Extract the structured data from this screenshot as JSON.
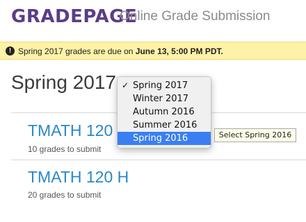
{
  "header": {
    "logo": "GRADEPAGE",
    "subtitle": "Online Grade Submission"
  },
  "banner": {
    "icon": "!",
    "text_prefix": "Spring 2017 grades are due on ",
    "text_bold": "June 13, 5:00 PM PDT."
  },
  "term": {
    "title": "Spring 2017"
  },
  "courses": [
    {
      "name": "TMATH 120",
      "sub": "10 grades to submit"
    },
    {
      "name": "TMATH 120 H",
      "sub": "20 grades to submit"
    }
  ],
  "term_dropdown": {
    "options": [
      "Spring 2017",
      "Winter 2017",
      "Autumn 2016",
      "Summer 2016",
      "Spring 2016"
    ],
    "checked": "Spring 2017",
    "highlighted": "Spring 2016",
    "check_glyph": "✓"
  },
  "tooltip": {
    "text": "Select Spring 2016"
  },
  "colors": {
    "brand": "#5b3c88",
    "link": "#2a88c6",
    "banner": "#fdf2a8",
    "highlight": "#3a7ff1"
  }
}
